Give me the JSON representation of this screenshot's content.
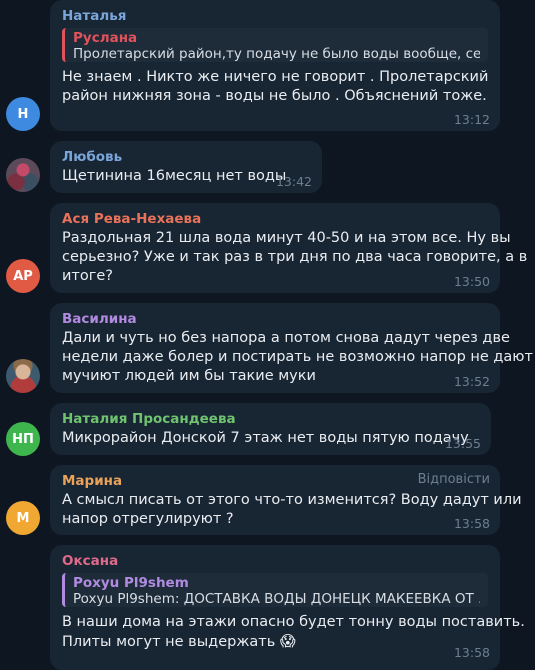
{
  "messages": [
    {
      "sender": "Наталья",
      "sender_color": "#7aa5d8",
      "reply": {
        "name": "Руслана",
        "text": "Пролетарский район,ту подачу не было воды вообще, се…",
        "color": "#e0535c"
      },
      "lines": [
        "Не знаем . Никто же ничего не говорит . Пролетарский",
        "район нижняя зона - воды не было . Объяснений тоже."
      ],
      "time": "13:12",
      "avatar": {
        "initials": "Н",
        "color": "#3e8ae0"
      }
    },
    {
      "sender": "Любовь",
      "sender_color": "#7aa5d8",
      "lines": [
        "Щетинина 16месяц нет воды"
      ],
      "time": "13:42",
      "avatar": {
        "initials": "",
        "photo": "user-photo"
      }
    },
    {
      "sender": "Ася Рева-Нехаева",
      "sender_color": "#e8725a",
      "lines": [
        "Раздольная 21 шла вода минут 40-50 и на этом все. Ну вы",
        "серьезно? Уже и так раз в три дня по два часа говорите, а в",
        "итоге?"
      ],
      "time": "13:50",
      "avatar": {
        "initials": "АР",
        "color": "#e15a43"
      }
    },
    {
      "sender": "Василина",
      "sender_color": "#b08be0",
      "lines": [
        "Дали и чуть но без напора а потом снова дадут через две",
        "недели даже болер и постирать не возможно напор не дают",
        "мучиют людей им бы такие муки"
      ],
      "time": "13:52",
      "avatar": {
        "initials": "",
        "photo": "user-photo"
      }
    },
    {
      "sender": "Наталия Просандеева",
      "sender_color": "#6fc36f",
      "lines": [
        "Микрорайон Донской 7 этаж нет воды  пятую подачу"
      ],
      "time": "13:55",
      "avatar": {
        "initials": "НП",
        "color": "#3fb54e"
      }
    },
    {
      "sender": "Марина",
      "sender_color": "#e8a25a",
      "tag": "Відповісти",
      "lines": [
        "А смысл писать от этого что-то изменится? Воду дадут или",
        "напор отрегулируют ?"
      ],
      "time": "13:58",
      "avatar": {
        "initials": "М",
        "color": "#f0a833"
      }
    },
    {
      "sender": "Оксана",
      "sender_color": "#e06a8a",
      "reply": {
        "name": "Poxyu Pl9shem",
        "text": "Poxyu Pl9shem: ДОСТАВКА ВОДЫ ДОНЕЦК МАКЕЕВКА ОТ …",
        "color": "#b08be0"
      },
      "lines": [
        "В наши дома на этажи опасно будет тонну воды поставить.",
        "Плиты могут не выдержать"
      ],
      "emoji": "😱",
      "time": "13:58"
    }
  ]
}
